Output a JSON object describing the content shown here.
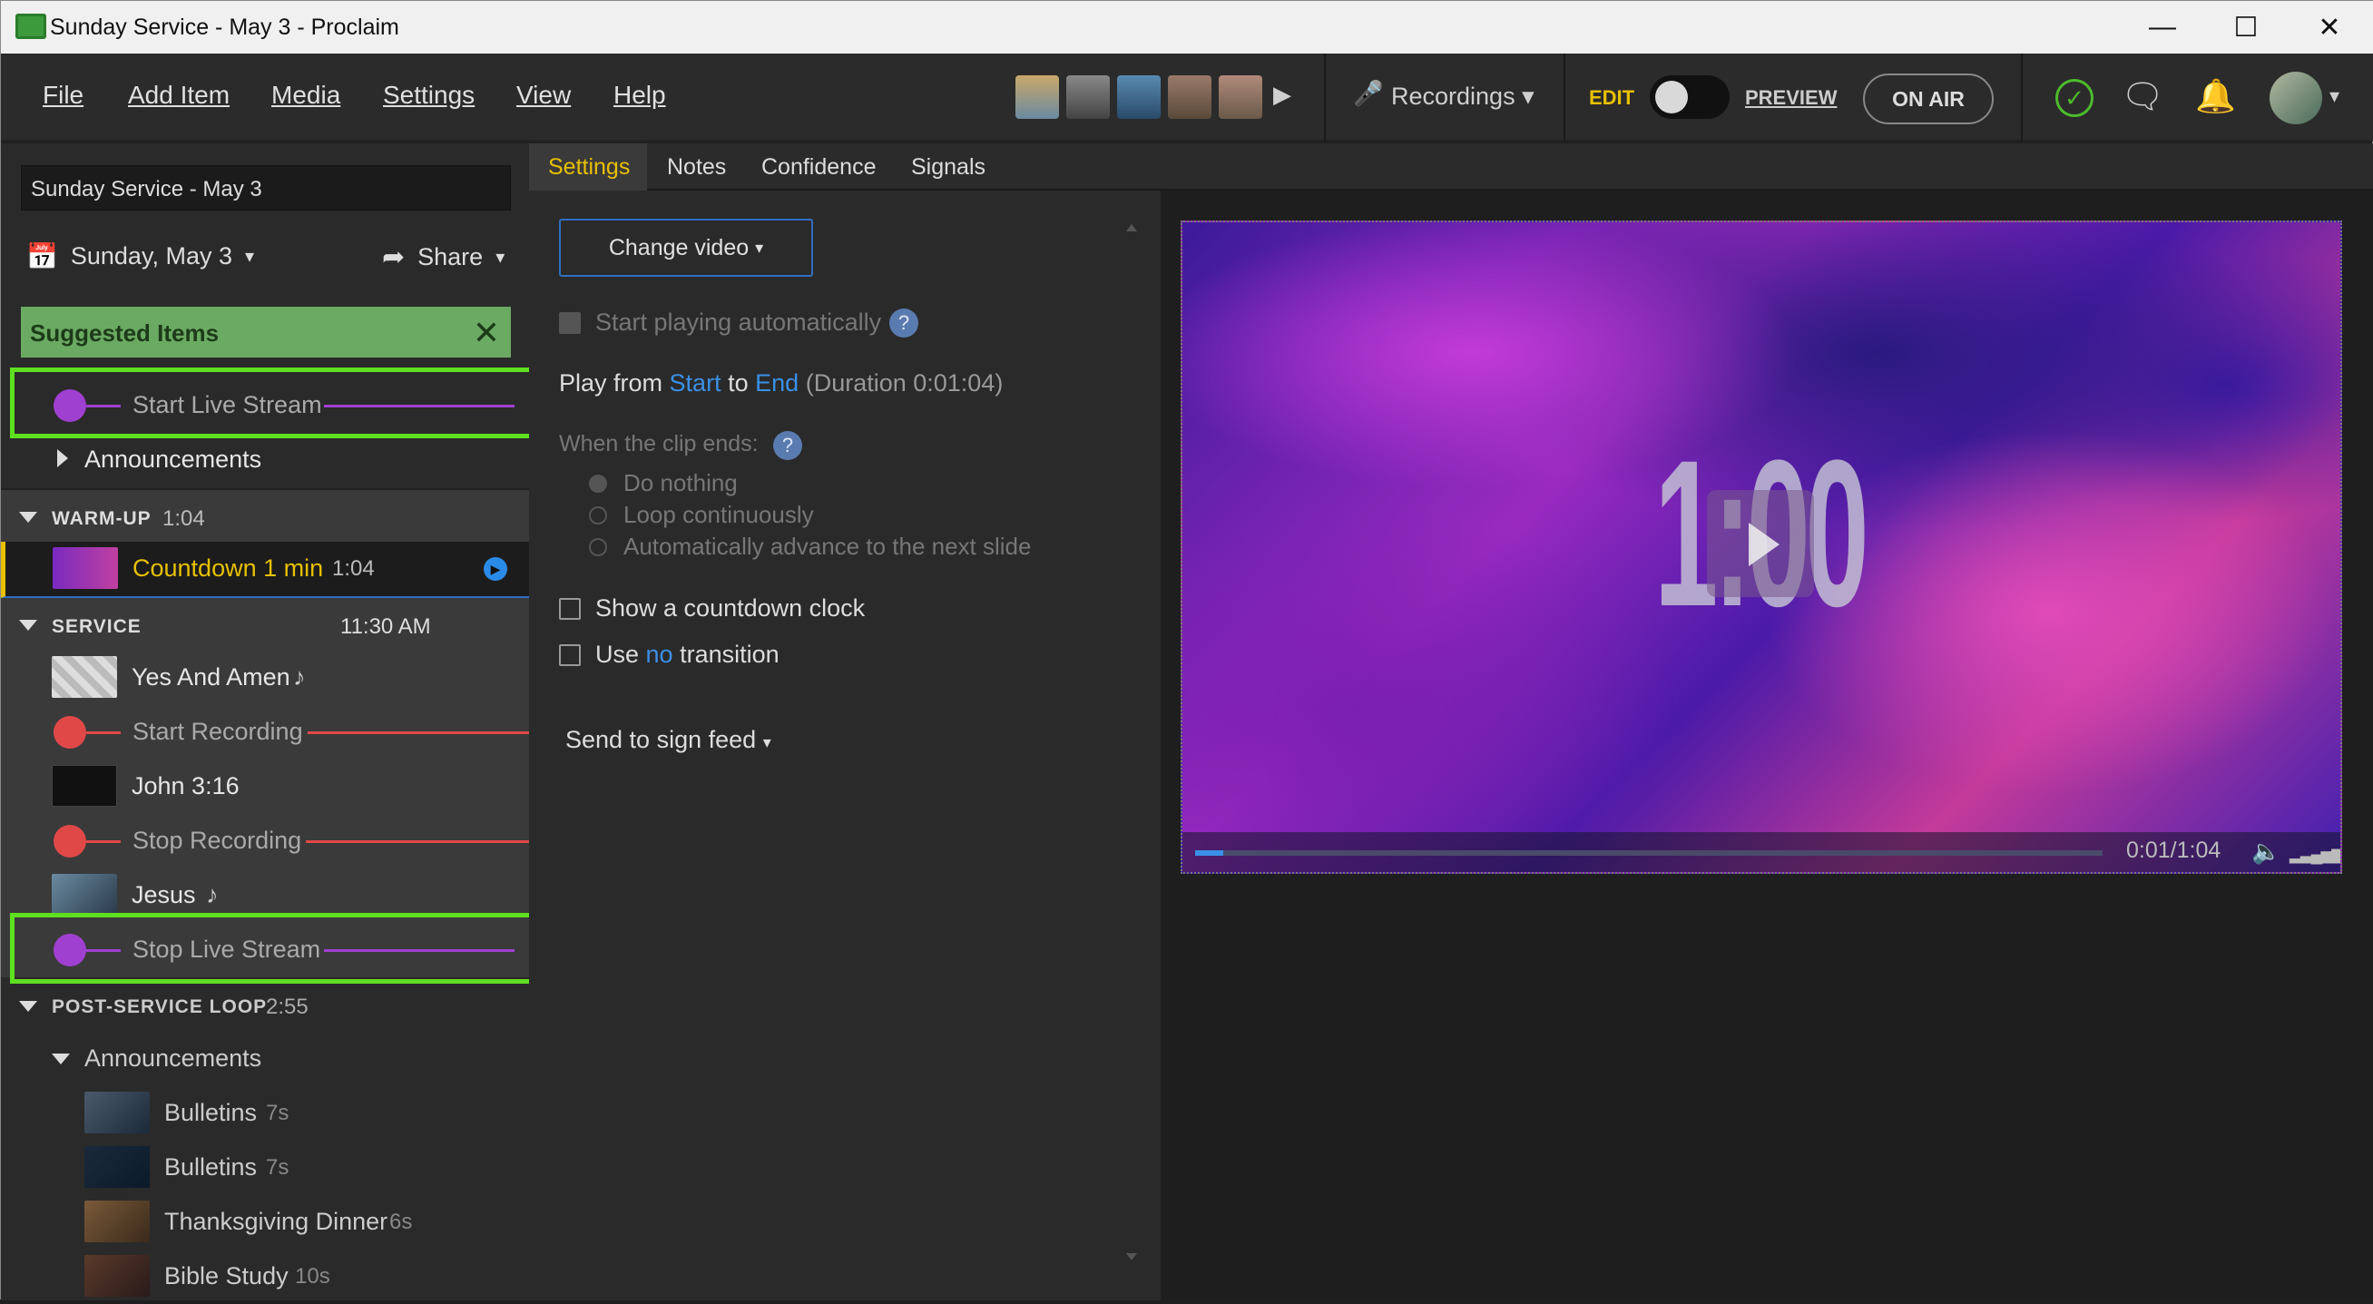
{
  "window": {
    "title": "Sunday Service - May 3 - Proclaim"
  },
  "menu": {
    "file": "File",
    "add_item": "Add Item",
    "media": "Media",
    "settings": "Settings",
    "view": "View",
    "help": "Help"
  },
  "toolbar": {
    "recordings": "Recordings",
    "edit": "EDIT",
    "preview": "PREVIEW",
    "on_air": "ON AIR"
  },
  "service": {
    "name": "Sunday Service - May 3",
    "date": "Sunday, May 3",
    "share": "Share"
  },
  "suggested": {
    "title": "Suggested Items"
  },
  "items": {
    "start_live_stream": "Start Live Stream",
    "announcements_top": "Announcements",
    "warmup_label": "WARM-UP",
    "warmup_time": "1:04",
    "countdown": "Countdown 1 min",
    "countdown_time": "1:04",
    "service_label": "SERVICE",
    "service_time": "11:30 AM",
    "yes_and_amen": "Yes And Amen",
    "start_recording": "Start Recording",
    "john": "John 3:16",
    "stop_recording": "Stop Recording",
    "jesus": "Jesus",
    "stop_live_stream": "Stop Live Stream",
    "post_label": "POST-SERVICE LOOP",
    "post_time": "2:55",
    "announcements_group": "Announcements",
    "bulletins1": "Bulletins",
    "bulletins1_time": "7s",
    "bulletins2": "Bulletins",
    "bulletins2_time": "7s",
    "thanksgiving": "Thanksgiving Dinner",
    "thanksgiving_time": "6s",
    "bible_study": "Bible Study",
    "bible_study_time": "10s"
  },
  "tabs": {
    "settings": "Settings",
    "notes": "Notes",
    "confidence": "Confidence",
    "signals": "Signals"
  },
  "settings": {
    "change_video": "Change video",
    "autoplay": "Start playing automatically",
    "play_from": "Play from",
    "start": "Start",
    "to": "to",
    "end": "End",
    "duration": "(Duration 0:01:04)",
    "clip_ends": "When the clip ends:",
    "do_nothing": "Do nothing",
    "loop": "Loop continuously",
    "advance": "Automatically advance to the next slide",
    "countdown_clock": "Show a countdown clock",
    "use": "Use",
    "no": "no",
    "transition": "transition",
    "send_sign": "Send to sign feed"
  },
  "preview": {
    "big_text": "1:00",
    "time": "0:01/1:04",
    "progress": 0.0156
  },
  "colors": {
    "accent_yellow": "#e8c000",
    "highlight_green": "#5ee020",
    "link_blue": "#3a90e8",
    "cue_red": "#e04848",
    "cue_purple": "#a040d0",
    "suggest_green": "#6aaa62"
  }
}
